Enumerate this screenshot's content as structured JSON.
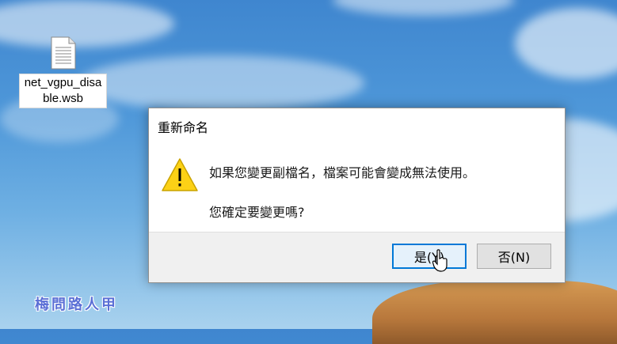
{
  "desktop": {
    "file_icon": "document-icon",
    "file_name": "net_vgpu_disable.wsb"
  },
  "dialog": {
    "title": "重新命名",
    "icon": "warning-icon",
    "message": "如果您變更副檔名，檔案可能會變成無法使用。",
    "question": "您確定要變更嗎?",
    "buttons": {
      "yes_label": "是(Y)",
      "no_label": "否(N)"
    },
    "accent_color": "#0078d7"
  },
  "watermark": "梅問路人甲"
}
